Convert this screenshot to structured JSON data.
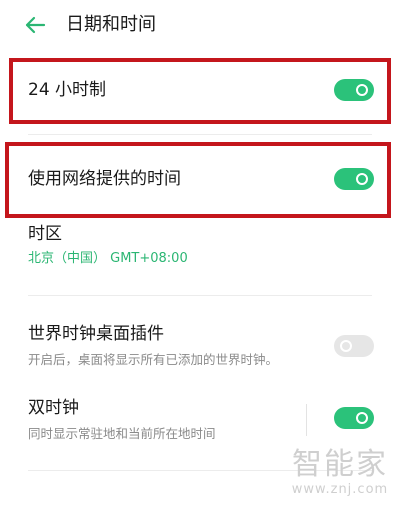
{
  "header": {
    "title": "日期和时间",
    "back_icon": "arrow-left-icon"
  },
  "settings": {
    "hour24": {
      "label": "24 小时制",
      "enabled": true
    },
    "network_time": {
      "label": "使用网络提供的时间",
      "enabled": true
    },
    "timezone": {
      "label": "时区",
      "value": "北京（中国） GMT+08:00"
    },
    "world_clock_widget": {
      "label": "世界时钟桌面插件",
      "description": "开启后，桌面将显示所有已添加的世界时钟。",
      "enabled": false
    },
    "dual_clock": {
      "label": "双时钟",
      "description": "同时显示常驻地和当前所在地时间",
      "enabled": true
    }
  },
  "watermark": {
    "brand": "智能家",
    "url": "www.znj.com"
  },
  "colors": {
    "accent": "#2bc27a",
    "highlight": "#c4161c",
    "toggle_off": "#e6e6e6"
  }
}
